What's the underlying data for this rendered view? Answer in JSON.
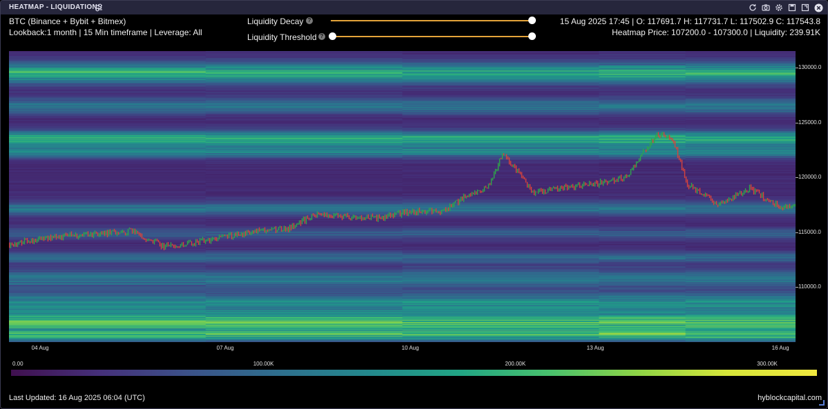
{
  "window": {
    "title": "HEATMAP - LIQUIDATIONS"
  },
  "header": {
    "symbol": "BTC (Binance + Bybit + Bitmex)",
    "params": "Lookback:1 month | 15 Min timeframe | Leverage: All",
    "ohlc": "15 Aug 2025 17:45 | O: 117691.7 H: 117731.7 L: 117502.9 C: 117543.8",
    "heatmap_info": "Heatmap Price: 107200.0 - 107300.0 | Liquidity: 239.91K"
  },
  "sliders": [
    {
      "label": "Liquidity Decay",
      "value": 1.0
    },
    {
      "label": "Liquidity Threshold",
      "value": 1.0
    }
  ],
  "colors": {
    "accent": "#e5a43a",
    "heat_low": "#40104f",
    "heat_mid": "#23898d",
    "heat_high": "#f0e83e",
    "candle_up": "#2ea84a",
    "candle_down": "#d9433c"
  },
  "chart_data": {
    "type": "heatmap",
    "title": "",
    "xlabel": "",
    "ylabel": "",
    "x_ticks": [
      "04 Aug",
      "07 Aug",
      "10 Aug",
      "13 Aug",
      "16 Aug"
    ],
    "y_ticks": [
      "130000.0",
      "125000.0",
      "120000.0",
      "115000.0",
      "110000.0"
    ],
    "y_tick_values": [
      130000,
      125000,
      120000,
      115000,
      110000
    ],
    "ylim": [
      105000,
      131500
    ],
    "x_range": [
      "2025-08-03 12:00",
      "2025-08-16 06:00"
    ],
    "colorbar": {
      "ticks": [
        "0.00",
        "100.00K",
        "200.00K",
        "300.00K"
      ],
      "tick_values": [
        0,
        100000,
        200000,
        300000
      ],
      "range": [
        0,
        320000
      ]
    },
    "price_series": {
      "name": "BTC price",
      "x": [
        "2025-08-03 12:00",
        "2025-08-04 00:00",
        "2025-08-04 12:00",
        "2025-08-05 00:00",
        "2025-08-05 12:00",
        "2025-08-06 00:00",
        "2025-08-06 12:00",
        "2025-08-07 00:00",
        "2025-08-07 12:00",
        "2025-08-08 00:00",
        "2025-08-08 12:00",
        "2025-08-09 00:00",
        "2025-08-09 12:00",
        "2025-08-10 00:00",
        "2025-08-10 12:00",
        "2025-08-11 00:00",
        "2025-08-11 06:00",
        "2025-08-11 12:00",
        "2025-08-12 00:00",
        "2025-08-12 12:00",
        "2025-08-13 00:00",
        "2025-08-13 12:00",
        "2025-08-14 00:00",
        "2025-08-14 06:00",
        "2025-08-14 12:00",
        "2025-08-15 00:00",
        "2025-08-15 12:00",
        "2025-08-16 00:00",
        "2025-08-16 06:00"
      ],
      "y": [
        113900,
        114400,
        114700,
        114900,
        115100,
        113700,
        114100,
        114600,
        115100,
        115300,
        116700,
        116400,
        116300,
        116900,
        116900,
        118600,
        119000,
        122200,
        118600,
        119100,
        119400,
        120000,
        124000,
        123600,
        119300,
        117600,
        119000,
        117300,
        117600
      ]
    }
  }
}
